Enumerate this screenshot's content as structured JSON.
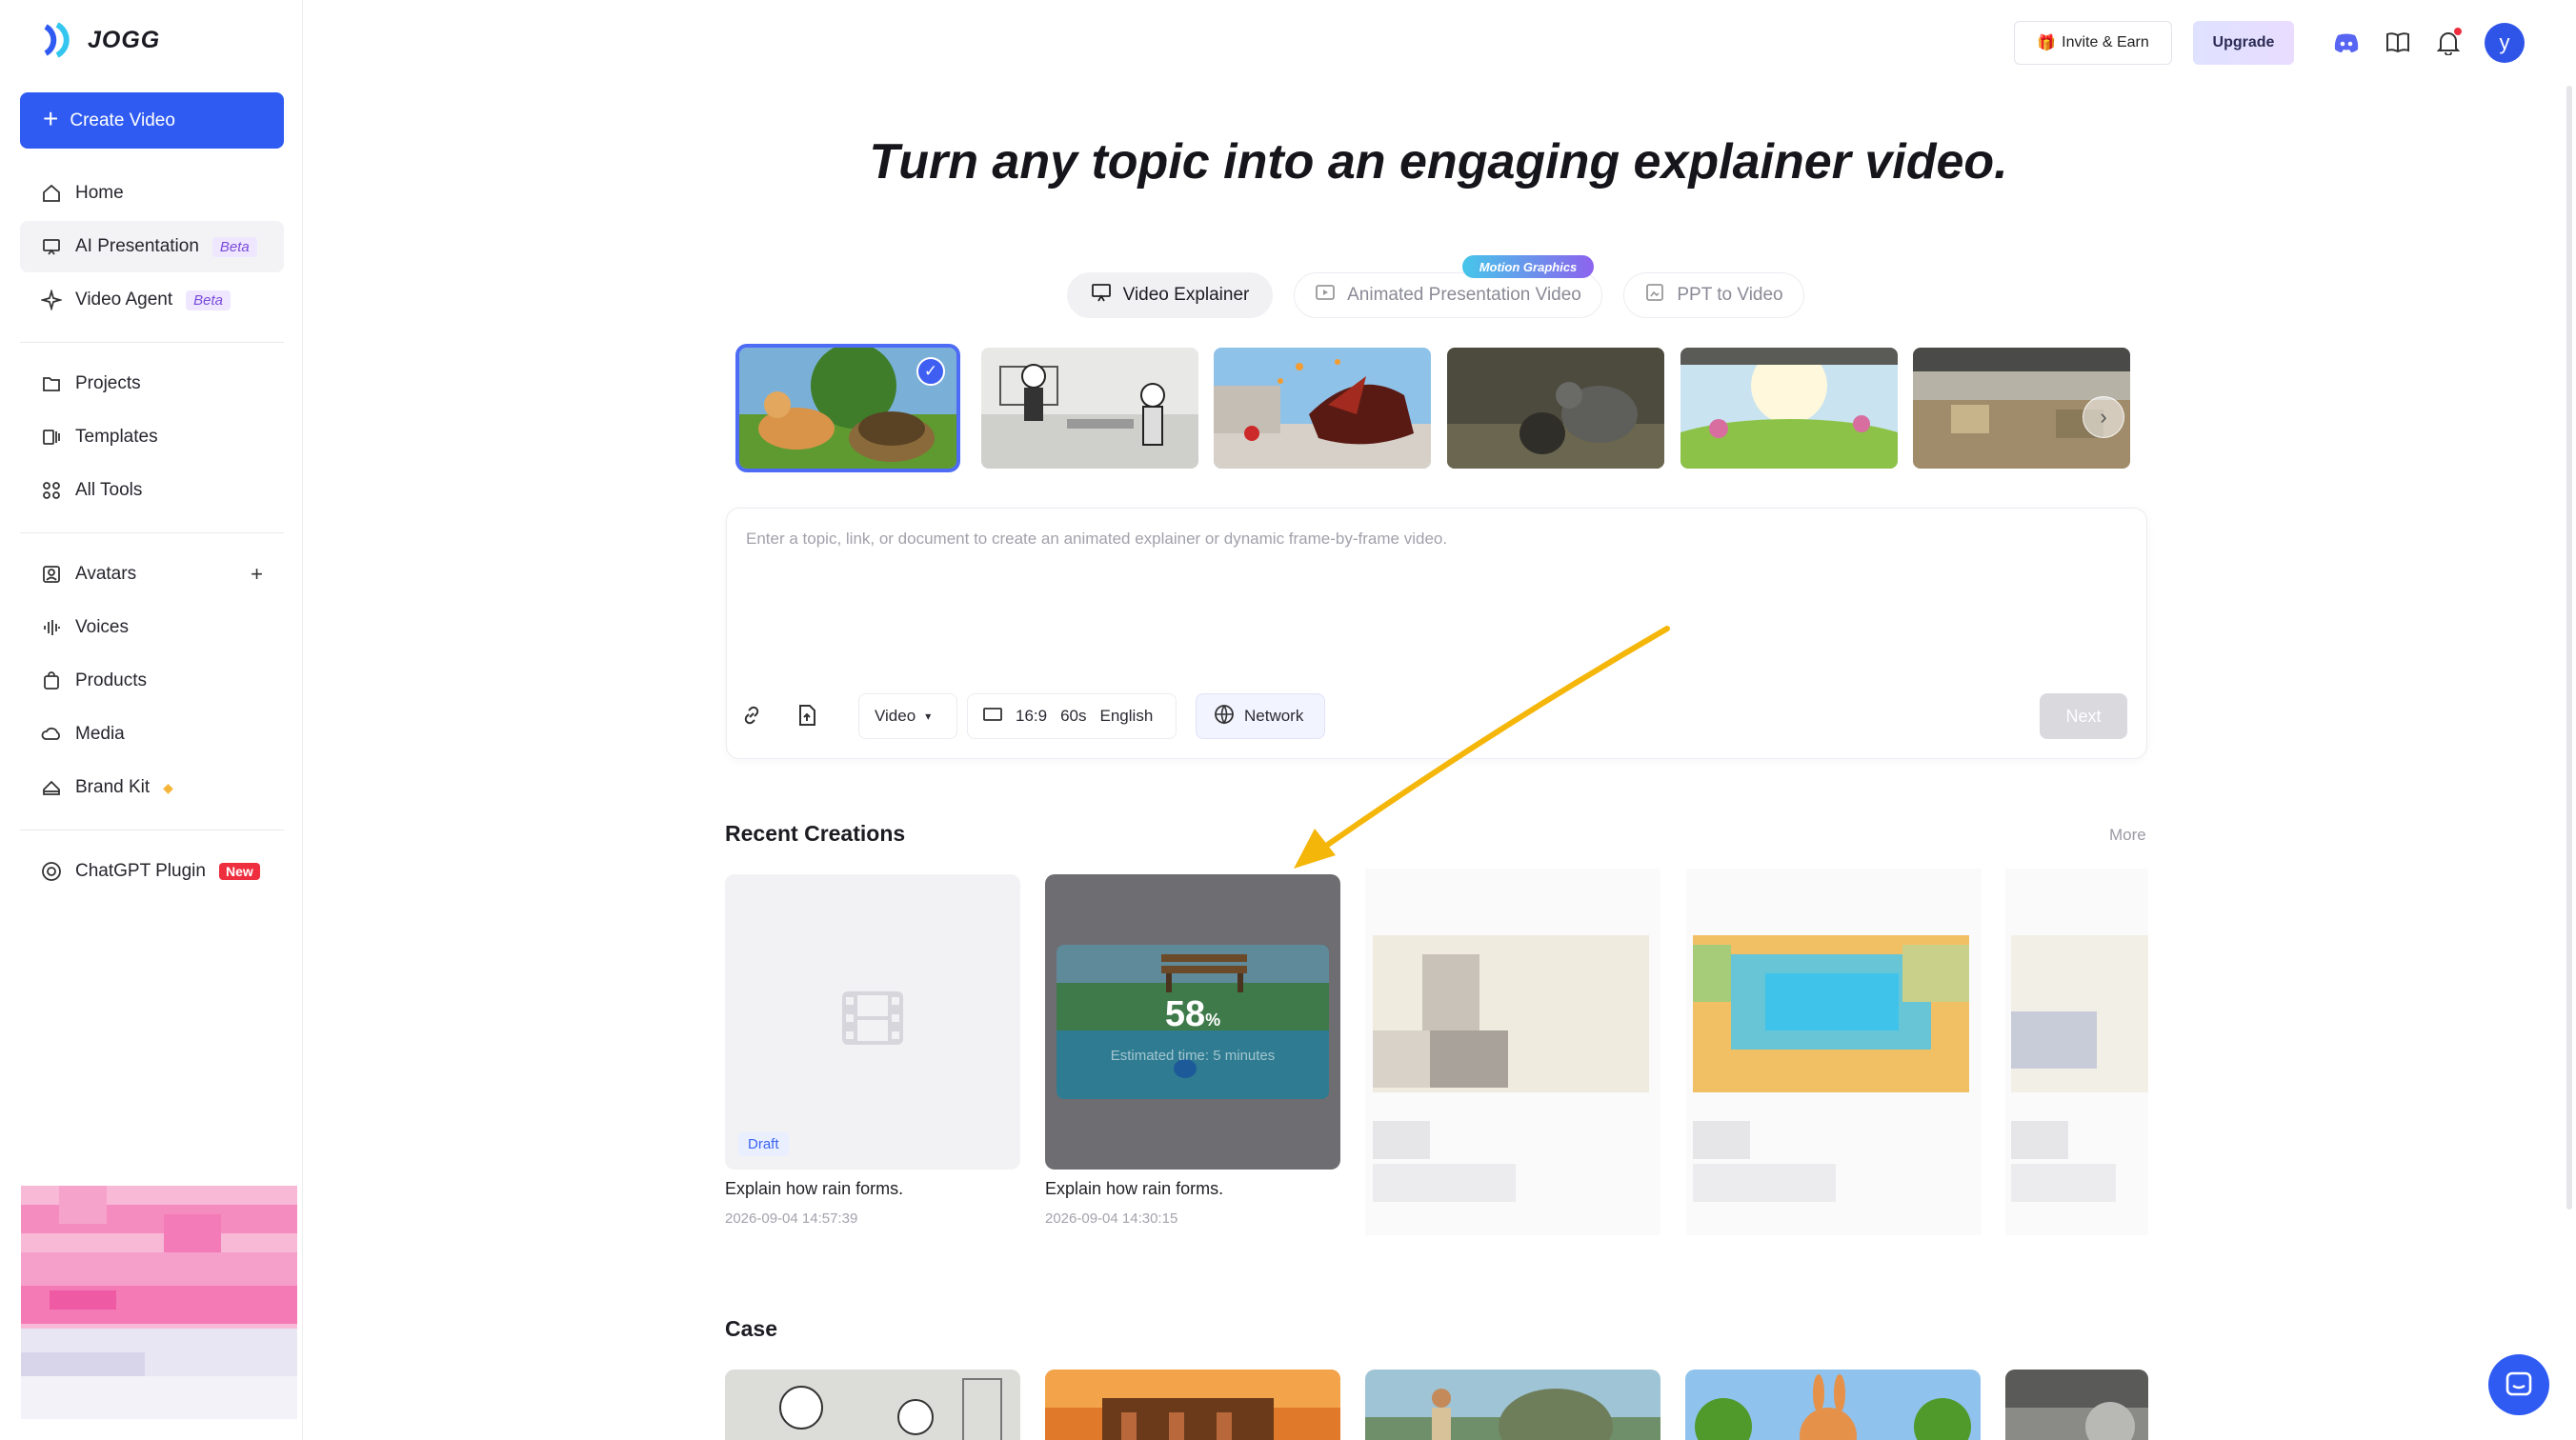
{
  "brand": {
    "name": "JOGG"
  },
  "sidebar": {
    "create_label": "Create Video",
    "items": [
      {
        "label": "Home",
        "icon": "home-icon"
      },
      {
        "label": "AI Presentation",
        "icon": "presentation-icon",
        "badge": "Beta"
      },
      {
        "label": "Video Agent",
        "icon": "sparkle-icon",
        "badge": "Beta"
      },
      {
        "label": "Projects",
        "icon": "folder-icon"
      },
      {
        "label": "Templates",
        "icon": "templates-icon"
      },
      {
        "label": "All Tools",
        "icon": "grid-icon"
      },
      {
        "label": "Avatars",
        "icon": "avatar-icon"
      },
      {
        "label": "Voices",
        "icon": "waveform-icon"
      },
      {
        "label": "Products",
        "icon": "bag-icon"
      },
      {
        "label": "Media",
        "icon": "cloud-icon"
      },
      {
        "label": "Brand Kit",
        "icon": "brand-icon"
      },
      {
        "label": "ChatGPT Plugin",
        "icon": "openai-icon",
        "badge": "New"
      }
    ]
  },
  "header": {
    "invite_label": "Invite & Earn",
    "upgrade_label": "Upgrade",
    "avatar_initial": "y"
  },
  "hero": {
    "title": "Turn any topic into an engaging explainer video."
  },
  "mode_tabs": [
    {
      "label": "Video Explainer",
      "active": true
    },
    {
      "label": "Animated Presentation Video",
      "badge": "Motion Graphics"
    },
    {
      "label": "PPT to Video"
    }
  ],
  "prompt": {
    "placeholder": "Enter a topic, link, or document to create an animated explainer or dynamic frame-by-frame video.",
    "type_value": "Video",
    "ratio": "16:9",
    "duration": "60s",
    "language": "English",
    "network_label": "Network",
    "next_label": "Next"
  },
  "recent": {
    "title": "Recent Creations",
    "more_label": "More",
    "items": [
      {
        "title": "Explain how rain forms.",
        "date": "2026-09-04 14:57:39",
        "status": "Draft"
      },
      {
        "title": "Explain how rain forms.",
        "date": "2026-09-04 14:30:15",
        "progress": "58",
        "progress_unit": "%",
        "eta": "Estimated time: 5 minutes"
      }
    ]
  },
  "case": {
    "title": "Case"
  },
  "colors": {
    "accent": "#2f5bf2",
    "beta": "#7a4ad9",
    "new": "#ee2e3e",
    "annotation_arrow": "#f5b60a"
  }
}
